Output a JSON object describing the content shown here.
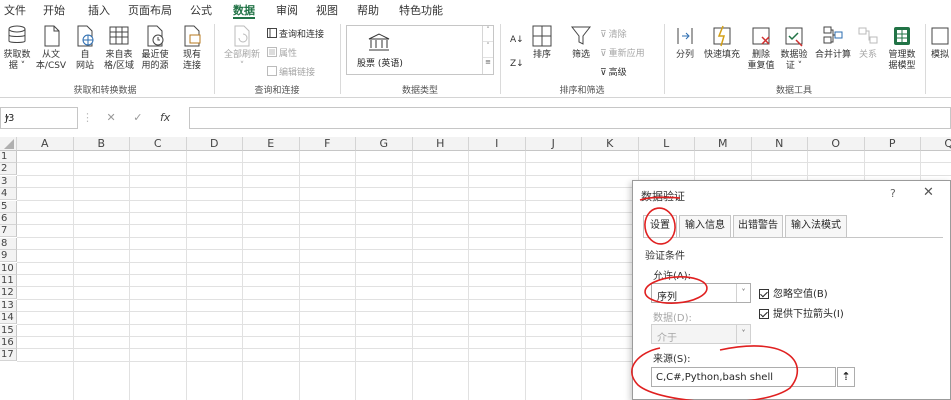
{
  "menu": {
    "tabs": [
      "文件",
      "开始",
      "插入",
      "页面布局",
      "公式",
      "数据",
      "审阅",
      "视图",
      "帮助",
      "特色功能"
    ],
    "active": "数据"
  },
  "ribbon": {
    "get_data": {
      "btn1": [
        "获取数",
        "据 ˅"
      ],
      "btn2": [
        "从文",
        "本/CSV"
      ],
      "btn3": [
        "自",
        "网站"
      ],
      "btn4": [
        "来自表",
        "格/区域"
      ],
      "btn5": [
        "最近使",
        "用的源"
      ],
      "btn6": [
        "现有",
        "连接"
      ],
      "group": "获取和转换数据"
    },
    "queries": {
      "refresh_all": [
        "全部刷新",
        "˅"
      ],
      "queries_connections": "查询和连接",
      "properties": "属性",
      "edit_links": "编辑链接",
      "group": "查询和连接"
    },
    "data_types": {
      "stock": "股票 (英语)",
      "group": "数据类型"
    },
    "sort_filter": {
      "sort": "排序",
      "filter": "筛选",
      "clear": "清除",
      "reapply": "重新应用",
      "advanced": "高级",
      "group": "排序和筛选"
    },
    "data_tools": {
      "split": "分列",
      "flash_fill": "快速填充",
      "remove_dup": [
        "删除",
        "重复值"
      ],
      "validation": [
        "数据验",
        "证 ˅"
      ],
      "consolidate": "合并计算",
      "relationships": "关系",
      "manage_model": [
        "管理数",
        "据模型"
      ],
      "group": "数据工具"
    },
    "what_if": "模拟"
  },
  "formula_bar": {
    "name_box": "J3",
    "fx": "fx",
    "cancel": "✕",
    "enter": "✓",
    "value": ""
  },
  "grid": {
    "columns": [
      "A",
      "B",
      "C",
      "D",
      "E",
      "F",
      "G",
      "H",
      "I",
      "J",
      "K",
      "L",
      "M",
      "N",
      "O",
      "P",
      "Q"
    ],
    "rows": [
      "1",
      "2",
      "3",
      "4",
      "5",
      "6",
      "7",
      "8",
      "9",
      "10",
      "11",
      "12",
      "13",
      "14",
      "15",
      "16",
      "17"
    ]
  },
  "dialog": {
    "title": "数据验证",
    "help": "?",
    "close": "✕",
    "tabs": [
      "设置",
      "输入信息",
      "出错警告",
      "输入法模式"
    ],
    "active_tab": "设置",
    "section": "验证条件",
    "allow_label": "允许(A):",
    "allow_value": "序列",
    "ignore_blank": "忽略空值(B)",
    "dropdown": "提供下拉箭头(I)",
    "data_label": "数据(D):",
    "data_value": "介于",
    "source_label": "来源(S):",
    "source_value": "C,C#,Python,bash shell"
  },
  "colors": {
    "accent": "#217346",
    "annotation": "#e02020"
  }
}
